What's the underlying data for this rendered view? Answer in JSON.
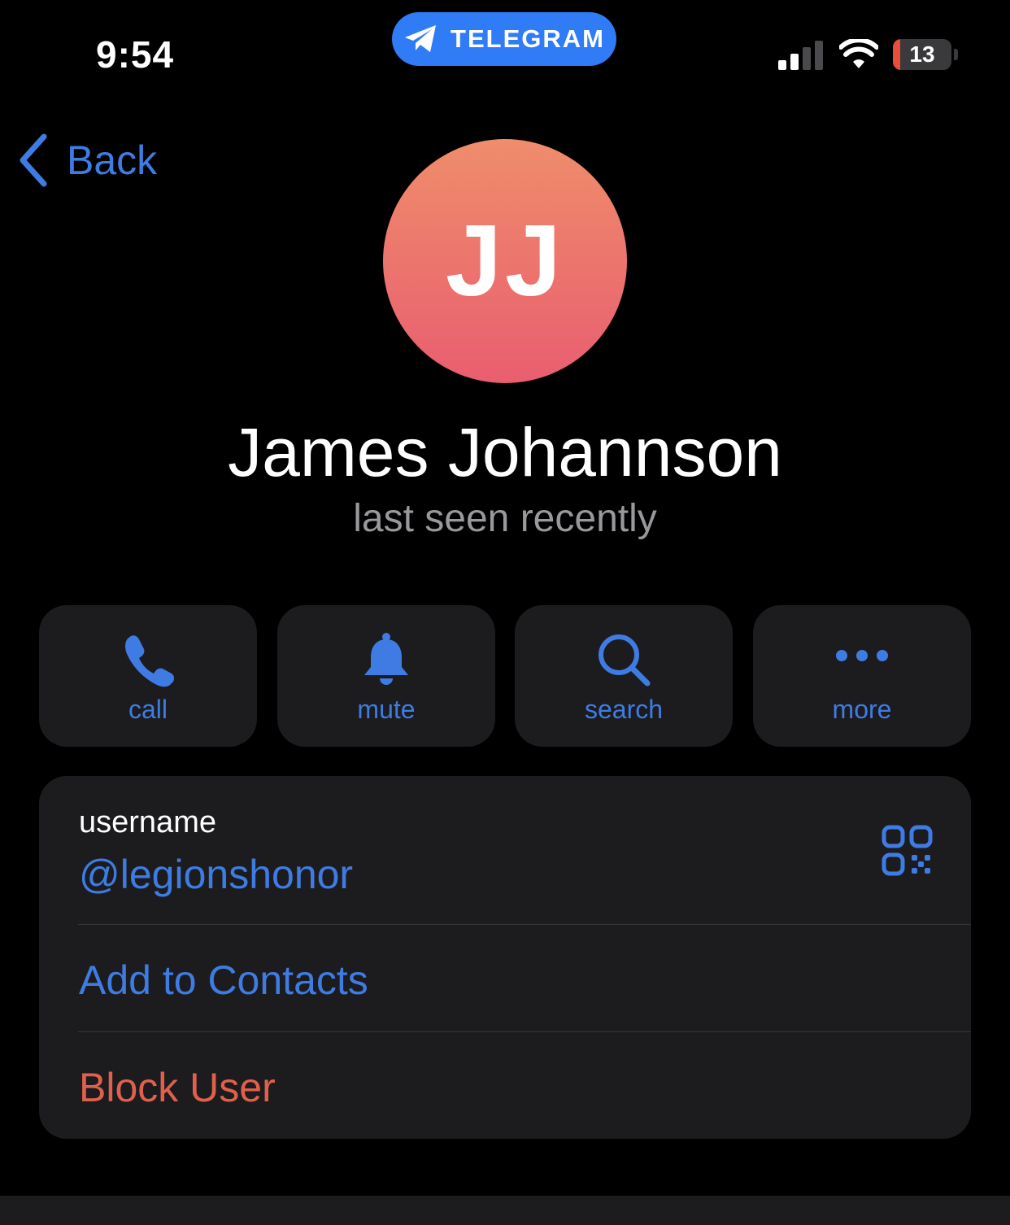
{
  "status_bar": {
    "time": "9:54",
    "app_pill_label": "TELEGRAM",
    "battery_level": "13",
    "battery_fraction": 0.13
  },
  "nav": {
    "back_label": "Back"
  },
  "profile": {
    "initials": "JJ",
    "name": "James Johannson",
    "status": "last seen recently"
  },
  "actions": [
    {
      "label": "call",
      "icon": "phone-icon"
    },
    {
      "label": "mute",
      "icon": "bell-icon"
    },
    {
      "label": "search",
      "icon": "search-icon"
    },
    {
      "label": "more",
      "icon": "more-dots-icon"
    }
  ],
  "info": {
    "username_label": "username",
    "username_value": "@legionshonor",
    "add_contact_label": "Add to Contacts",
    "block_label": "Block User"
  },
  "colors": {
    "accent": "#3e7ce4",
    "destructive": "#e0604e",
    "pill": "#2f7cf6",
    "card": "#1c1c1e",
    "avatar_top": "#ef8d6b",
    "avatar_bottom": "#e95e70"
  }
}
